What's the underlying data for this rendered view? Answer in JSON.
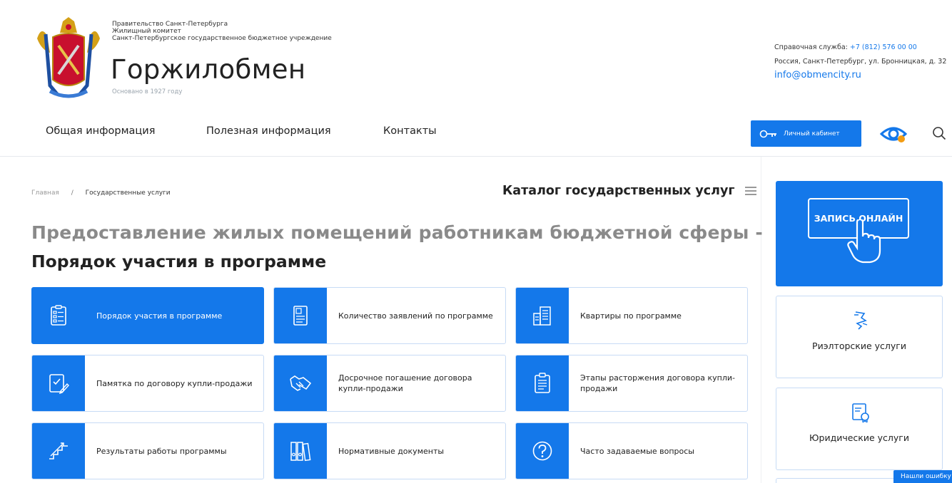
{
  "header": {
    "gov_line_1": "Правительство Санкт-Петербурга",
    "gov_line_2": "Жилищный комитет",
    "gov_line_3": "Санкт-Петербургское государственное бюджетное учреждение",
    "brand": "Горжилобмен",
    "founded": "Основано в 1927 году",
    "help_label": "Справочная служба: ",
    "phone": "+7 (812) 576 00 00",
    "address": "Россия, Санкт-Петербург, ул. Бронницкая, д. 32",
    "email": "info@obmencity.ru"
  },
  "nav": {
    "items": [
      {
        "label": "Общая информация"
      },
      {
        "label": "Полезная информация"
      },
      {
        "label": "Контакты"
      }
    ],
    "cabinet_label": "Личный кабинет"
  },
  "breadcrumb": {
    "home": "Главная",
    "separator": "/",
    "current": "Государственные услуги"
  },
  "catalog_label": "Каталог государственных услуг",
  "title": {
    "line1": "Предоставление жилых помещений работникам бюджетной сферы -",
    "line2": "Порядок участия в программе"
  },
  "tiles": [
    {
      "label": "Порядок участия в программе",
      "icon": "checklist-icon",
      "active": true
    },
    {
      "label": "Количество заявлений по программе",
      "icon": "document-icon",
      "active": false
    },
    {
      "label": "Квартиры по программе",
      "icon": "buildings-icon",
      "active": false
    },
    {
      "label": "Памятка по договору купли-продажи",
      "icon": "contract-edit-icon",
      "active": false
    },
    {
      "label": "Досрочное погашение договора купли-продажи",
      "icon": "handshake-icon",
      "active": false
    },
    {
      "label": "Этапы расторжения договора купли-продажи",
      "icon": "clipboard-list-icon",
      "active": false
    },
    {
      "label": "Результаты работы программы",
      "icon": "stairs-icon",
      "active": false
    },
    {
      "label": "Нормативные документы",
      "icon": "binders-icon",
      "active": false
    },
    {
      "label": "Часто задаваемые вопросы",
      "icon": "question-icon",
      "active": false
    }
  ],
  "sidebar": {
    "online_label": "ЗАПИСЬ ОНЛАЙН",
    "cards": [
      {
        "label": "Риэлторские услуги",
        "icon": "realtor-icon"
      },
      {
        "label": "Юридические услуги",
        "icon": "legal-doc-icon"
      }
    ]
  },
  "error_button": "Нашли ошибку",
  "colors": {
    "accent": "#1478ea",
    "tile_border": "#c7dbf5",
    "title_gray": "#8a8a8a"
  }
}
